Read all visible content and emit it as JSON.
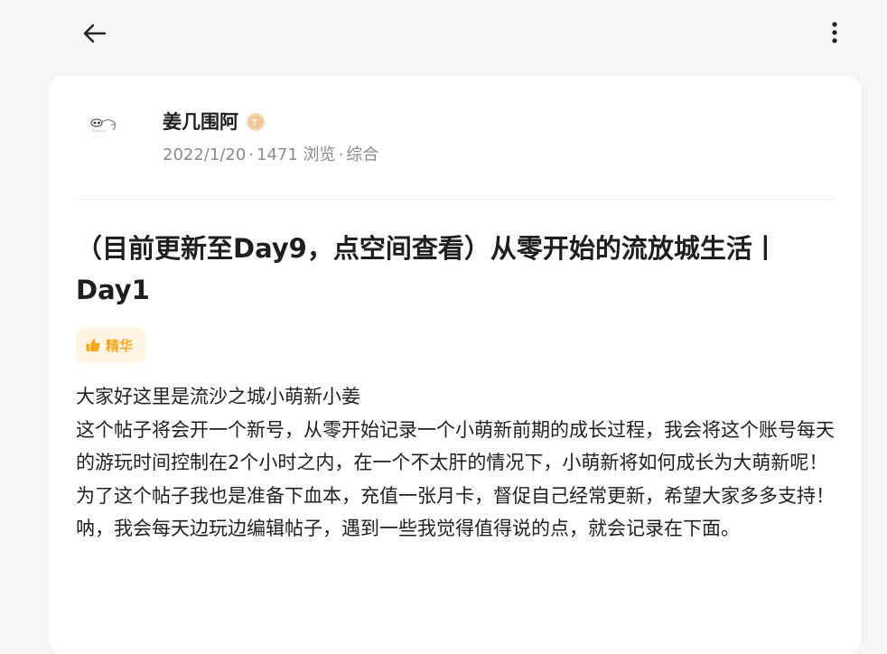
{
  "header": {
    "back_icon": "arrow-left-icon",
    "more_icon": "more-vertical-icon"
  },
  "post": {
    "author": {
      "name": "姜几围阿",
      "avatar_icon": "avatar-sketch-icon",
      "level_badge": "T",
      "level_badge_color": "#f1c59a"
    },
    "meta": {
      "date": "2022/1/20",
      "views": "1471 浏览",
      "category": "综合"
    },
    "title": "（目前更新至Day9，点空间查看）从零开始的流放城生活丨Day1",
    "tag": {
      "icon": "thumbs-up-icon",
      "label": "精华",
      "color": "#f5a623",
      "background": "#fff4e2"
    },
    "paragraphs": [
      "大家好这里是流沙之城小萌新小姜",
      "这个帖子将会开一个新号，从零开始记录一个小萌新前期的成长过程，我会将这个账号每天的游玩时间控制在2个小时之内，在一个不太肝的情况下，小萌新将如何成长为大萌新呢！",
      "为了这个帖子我也是准备下血本，充值一张月卡，督促自己经常更新，希望大家多多支持！",
      "呐，我会每天边玩边编辑帖子，遇到一些我觉得值得说的点，就会记录在下面。"
    ]
  }
}
